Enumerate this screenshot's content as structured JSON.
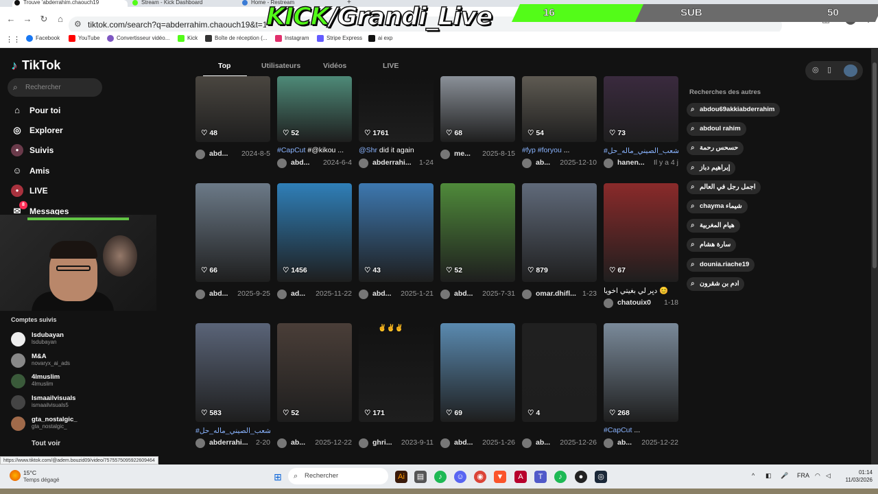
{
  "browser": {
    "tabs": [
      {
        "label": "Trouve 'abderrahim.chaouch19",
        "color": "#111111"
      },
      {
        "label": "Stream - Kick Dashboard",
        "color": "#53fc18"
      },
      {
        "label": "Home - Restream",
        "color": "#3a7bd5"
      }
    ],
    "url": "tiktok.com/search?q=abderrahim.chaouch19&t=177319148347",
    "bookmarks": [
      {
        "label": "Facebook",
        "color": "#1877f2"
      },
      {
        "label": "YouTube",
        "color": "#ff0000"
      },
      {
        "label": "Convertisseur vidéo...",
        "color": "#7e57c2"
      },
      {
        "label": "Kick",
        "color": "#53fc18"
      },
      {
        "label": "Boîte de réception (...",
        "color": "#333333"
      },
      {
        "label": "Instagram",
        "color": "#e1306c"
      },
      {
        "label": "Stripe Express",
        "color": "#635bff"
      },
      {
        "label": "ai exp",
        "color": "#111111"
      }
    ],
    "status_url": "https://www.tiktok.com/@adem.bouzid09/video/7575575095922609464"
  },
  "overlay": {
    "kick_prefix": "KICK",
    "kick_handle": "/Grandi_Live",
    "sub_current": "16",
    "sub_label": "SUB",
    "sub_goal": "50",
    "accent": "#53fc18"
  },
  "tiktok": {
    "logo": "TikTok",
    "search_placeholder": "Rechercher",
    "nav": [
      {
        "label": "Pour toi",
        "icon": "home-icon"
      },
      {
        "label": "Explorer",
        "icon": "compass-icon"
      },
      {
        "label": "Suivis",
        "icon": "following-icon"
      },
      {
        "label": "Amis",
        "icon": "friends-icon"
      },
      {
        "label": "LIVE",
        "icon": "live-icon"
      },
      {
        "label": "Messages",
        "icon": "messages-icon",
        "badge": "8"
      }
    ],
    "comptes_title": "Comptes suivis",
    "accounts": [
      {
        "name": "lsdubayan",
        "handle": "lsdubayan"
      },
      {
        "name": "M&A",
        "handle": "novaryx_ai_ads"
      },
      {
        "name": "4lmuslim",
        "handle": "4lmuslim"
      },
      {
        "name": "Ismaailvisuals",
        "handle": "ismaailvisuals5"
      },
      {
        "name": "gta_nostalgic_",
        "handle": "gta_nostalgic_"
      }
    ],
    "tout_voir": "Tout voir",
    "tabs": [
      "Top",
      "Utilisateurs",
      "Vidéos",
      "LIVE"
    ],
    "others_title": "Recherches des autres",
    "others": [
      "abdou69akkiabderrahim",
      "abdoul rahim",
      "حسحس رحمة",
      "إبراهيم دباز",
      "اجمل رجل في العالم",
      "chayma شيماء",
      "هيام المغربية",
      "سارة هشام",
      "dounia.riache19",
      "ادم بن شقرون"
    ],
    "row1": [
      {
        "likes": "48",
        "cap": "",
        "user": "abd...",
        "date": "2024-8-5",
        "bg": "#4a4640"
      },
      {
        "likes": "52",
        "cap_tag": "#CapCut",
        "cap": " #@kikou ...",
        "user": "abd...",
        "date": "2024-6-4",
        "bg": "#4e8a78"
      },
      {
        "likes": "1761",
        "cap_tag": "@Shr",
        "cap": " did it again",
        "user": "abderrahi...",
        "date": "1-24",
        "bg": "#121212"
      },
      {
        "likes": "68",
        "cap": "",
        "user": "me...",
        "date": "2025-8-15",
        "bg": "#8a9098"
      },
      {
        "likes": "54",
        "cap_tag": "#fyp #foryou",
        "cap": " ...",
        "user": "ab...",
        "date": "2025-12-10",
        "bg": "#5e5a52"
      },
      {
        "likes": "73",
        "cap_tag": "#الشعب_الصيني_ماله_حل",
        "cap": "😅",
        "user": "hanen...",
        "date": "Il y a 4 j",
        "bg": "#3a2a3e"
      }
    ],
    "row2": [
      {
        "likes": "66",
        "cap": "",
        "user": "abd...",
        "date": "2025-9-25",
        "bg": "#6c7a88"
      },
      {
        "likes": "1456",
        "cap": "",
        "user": "ad...",
        "date": "2025-11-22",
        "bg": "#2f7fb8"
      },
      {
        "likes": "43",
        "cap": "",
        "user": "abd...",
        "date": "2025-1-21",
        "bg": "#3d78b0"
      },
      {
        "likes": "52",
        "cap": "",
        "user": "abd...",
        "date": "2025-7-31",
        "bg": "#4f8a3a"
      },
      {
        "likes": "879",
        "cap": "",
        "user": "omar.dhifl...",
        "date": "1-23",
        "bg": "#606a7a"
      },
      {
        "likes": "67",
        "cap": "ديِر لي بغيتي اخويا 😊",
        "user": "chatouix0",
        "date": "1-18",
        "bg": "#8a2a2a"
      }
    ],
    "row3": [
      {
        "likes": "583",
        "cap_tag": "#الشعب_الصيني_ماله_حل",
        "cap": "😅",
        "user": "abderrahi...",
        "date": "2-20",
        "bg": "#5a6478"
      },
      {
        "likes": "52",
        "cap": "",
        "user": "ab...",
        "date": "2025-12-22",
        "bg": "#4a3e38"
      },
      {
        "likes": "171",
        "cap": "",
        "user": "ghri...",
        "date": "2023-9-11",
        "bg": "#121212",
        "emoji": "✌️✌️✌️"
      },
      {
        "likes": "69",
        "cap": "",
        "user": "abd...",
        "date": "2025-1-26",
        "bg": "#5a8ab0"
      },
      {
        "likes": "4",
        "cap": "",
        "user": "ab...",
        "date": "2025-12-26",
        "bg": "#202020"
      },
      {
        "likes": "268",
        "cap_tag": "#CapCut",
        "cap": " ...",
        "user": "ab...",
        "date": "2025-12-22",
        "bg": "#7a8a9a"
      }
    ]
  },
  "taskbar": {
    "temp": "15°C",
    "weather": "Temps dégagé",
    "search": "Rechercher",
    "lang": "FRA",
    "time": "01:14",
    "date": "11/03/2026"
  }
}
